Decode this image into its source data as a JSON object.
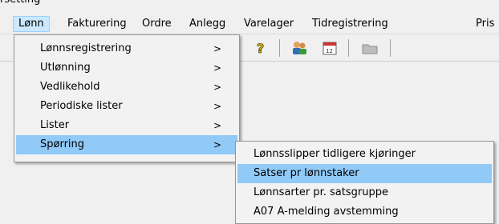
{
  "window": {
    "title_fragment": "rsetting"
  },
  "menubar": {
    "items": [
      {
        "label": "Lønn",
        "open": true
      },
      {
        "label": "Fakturering"
      },
      {
        "label": "Ordre"
      },
      {
        "label": "Anlegg"
      },
      {
        "label": "Varelager"
      },
      {
        "label": "Tidregistrering"
      },
      {
        "label": "Pris"
      }
    ]
  },
  "toolbar": {
    "icons": [
      "help-icon",
      "users-icon",
      "calendar-icon",
      "folder-icon"
    ]
  },
  "lonn_menu": {
    "items": [
      {
        "label": "Lønnsregistrering",
        "arrow": ">"
      },
      {
        "label": "Utlønning",
        "arrow": ">"
      },
      {
        "label": "Vedlikehold",
        "arrow": ">"
      },
      {
        "label": "Periodiske lister",
        "arrow": ">"
      },
      {
        "label": "Lister",
        "arrow": ">"
      },
      {
        "label": "Spørring",
        "arrow": ">",
        "highlighted": true
      }
    ]
  },
  "sporring_submenu": {
    "items": [
      {
        "label": "Lønnsslipper tidligere kjøringer"
      },
      {
        "label": "Satser pr lønnstaker",
        "highlighted": true
      },
      {
        "label": "Lønnsarter pr. satsgruppe"
      },
      {
        "label": "A07 A-melding avstemming"
      }
    ]
  },
  "colors": {
    "menu_highlight": "#91c9f7",
    "menubar_open": "#cce8ff"
  }
}
